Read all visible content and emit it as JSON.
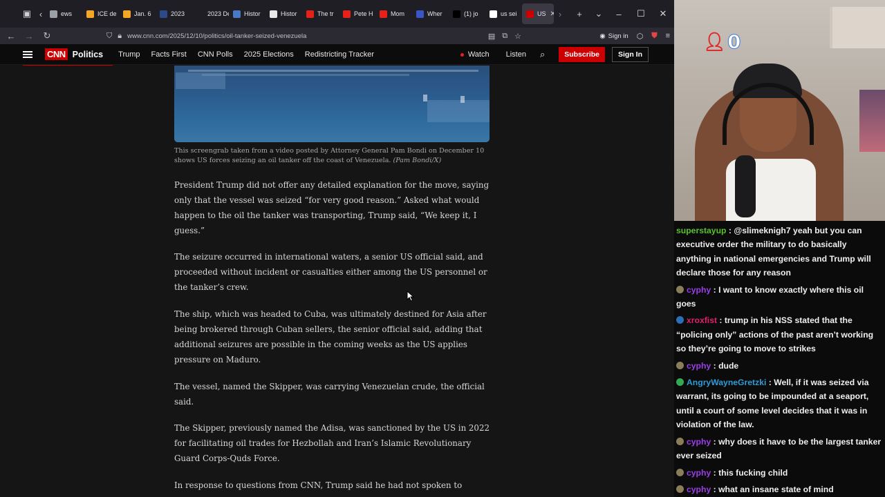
{
  "browser": {
    "tabs": [
      {
        "label": "ews",
        "favicon": "back-arrow",
        "color": "#9aa0a6"
      },
      {
        "label": "ICE de",
        "favicon": "nbc-peacock",
        "color": "#f5a623"
      },
      {
        "label": "Jan. 6",
        "favicon": "nbc-peacock",
        "color": "#f5a623"
      },
      {
        "label": "2023",
        "favicon": "seal",
        "color": "#2c4a8a"
      },
      {
        "label": "2023 Dem",
        "favicon": "none",
        "color": "#1f1e24"
      },
      {
        "label": "Histor",
        "favicon": "globe",
        "color": "#4a78c8"
      },
      {
        "label": "Histor",
        "favicon": "wikipedia",
        "color": "#e8e8e8"
      },
      {
        "label": "The tr",
        "favicon": "youtube",
        "color": "#e62117"
      },
      {
        "label": "Pete H",
        "favicon": "youtube",
        "color": "#e62117"
      },
      {
        "label": "Mom",
        "favicon": "youtube",
        "color": "#e62117"
      },
      {
        "label": "Wher",
        "favicon": "pause-bars",
        "color": "#3a55c8"
      },
      {
        "label": "(1) jo",
        "favicon": "x-logo",
        "color": "#000000"
      },
      {
        "label": "us sei",
        "favicon": "google",
        "color": "#ffffff"
      },
      {
        "label": "US",
        "favicon": "cnn",
        "color": "#cc0000",
        "active": true
      }
    ],
    "url": "www.cnn.com/2025/12/10/politics/oil-tanker-seized-venezuela",
    "sign_in_label": "Sign in",
    "window_controls": [
      "minimize",
      "maximize",
      "close"
    ]
  },
  "cnn": {
    "logo": "CNN",
    "section": "Politics",
    "nav_items": [
      "Trump",
      "Facts First",
      "CNN Polls",
      "2025 Elections",
      "Redistricting Tracker"
    ],
    "watch_label": "Watch",
    "listen_label": "Listen",
    "subscribe_label": "Subscribe",
    "signin_label": "Sign In",
    "brand_color": "#cc0000"
  },
  "article": {
    "caption_text": "This screengrab taken from a video posted by Attorney General Pam Bondi on December 10 shows US forces seizing an oil tanker off the coast of Venezuela.",
    "caption_credit": "(Pam Bondi/X)",
    "paragraphs": [
      "President Trump did not offer any detailed explanation for the move, saying only that the vessel was seized “for very good reason.” Asked what would happen to the oil the tanker was transporting, Trump said, “We keep it, I guess.”",
      "The seizure occurred in international waters, a senior US official said, and proceeded without incident or casualties either among the US personnel or the tanker’s crew.",
      "The ship, which was headed to Cuba, was ultimately destined for Asia after being brokered through Cuban sellers, the senior official said, adding that additional seizures are possible in the coming weeks as the US applies pressure on Maduro.",
      "The vessel, named the Skipper, was carrying Venezuelan crude, the official said.",
      "The Skipper, previously named the Adisa, was sanctioned by the US in 2022 for facilitating oil trades for Hezbollah and Iran’s Islamic Revolutionary Guard Corps-Quds Force.",
      "In response to questions from CNN, Trump said he had not spoken to"
    ]
  },
  "stream": {
    "viewer_count": "0"
  },
  "chat": {
    "messages": [
      {
        "user": "superstayup",
        "color": "#59c22c",
        "badge": "none",
        "text": "@slimeknigh7 yeah but you can executive order the military to do basically anything in national emergencies and Trump will declare those for any reason"
      },
      {
        "user": "cyphy",
        "color": "#9b3ee8",
        "badge": "avatar",
        "text": "I want to know exactly where this oil goes"
      },
      {
        "user": "xroxfist",
        "color": "#e0206a",
        "badge": "screen",
        "text": "trump in his NSS stated that the “policing only” actions of the past aren’t working so they’re going to move to strikes"
      },
      {
        "user": "cyphy",
        "color": "#9b3ee8",
        "badge": "avatar",
        "text": "dude"
      },
      {
        "user": "AngryWayneGretzki",
        "color": "#2e9bd6",
        "badge": "mod",
        "text": "Well, if it was seized via warrant, its going to be impounded at a seaport, until a court of some level decides that it was in violation of the law."
      },
      {
        "user": "cyphy",
        "color": "#9b3ee8",
        "badge": "avatar",
        "text": "why does it have to be the largest tanker ever seized"
      },
      {
        "user": "cyphy",
        "color": "#9b3ee8",
        "badge": "avatar",
        "text": "this fucking child"
      },
      {
        "user": "cyphy",
        "color": "#9b3ee8",
        "badge": "avatar",
        "text": "what an insane state of mind"
      }
    ]
  }
}
